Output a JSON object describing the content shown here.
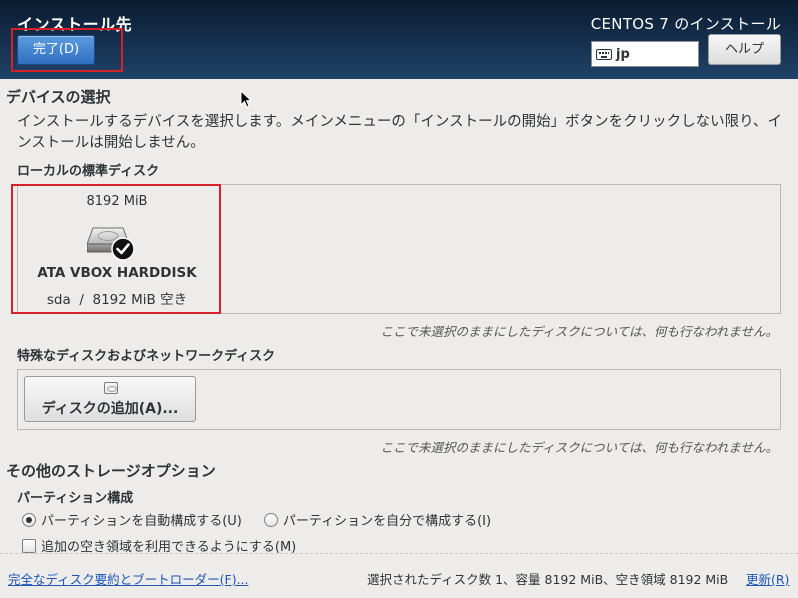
{
  "header": {
    "title": "インストール先",
    "done_label": "完了(D)",
    "product_title": "CENTOS 7 のインストール",
    "keyboard_layout": "jp",
    "help_label": "ヘルプ",
    "accent_color": "#3b7fd0"
  },
  "device_selection": {
    "title": "デバイスの選択",
    "description": "インストールするデバイスを選択します。メインメニューの「インストールの開始」ボタンをクリックしない限り、インストールは開始しません。"
  },
  "local_disks": {
    "title": "ローカルの標準ディスク",
    "disks": [
      {
        "size": "8192 MiB",
        "name": "ATA VBOX HARDDISK",
        "info": "sda  /  8192 MiB 空き",
        "selected": true,
        "icon": "harddisk-icon"
      }
    ],
    "note": "ここで未選択のままにしたディスクについては、何も行なわれません。"
  },
  "special_disks": {
    "title": "特殊なディスクおよびネットワークディスク",
    "add_disk_label": "ディスクの追加(A)...",
    "note": "ここで未選択のままにしたディスクについては、何も行なわれません。"
  },
  "other_storage": {
    "title": "その他のストレージオプション",
    "partitioning_title": "パーティション構成",
    "radio_auto": "パーティションを自動構成する(U)",
    "radio_manual": "パーティションを自分で構成する(I)",
    "checkbox_extra_space": "追加の空き領域を利用できるようにする(M)"
  },
  "footer": {
    "summary_link": "完全なディスク要約とブートローダー(F)...",
    "summary_text": "選択されたディスク数 1、容量 8192 MiB、空き領域 8192 MiB",
    "refresh_label": "更新(R)"
  }
}
